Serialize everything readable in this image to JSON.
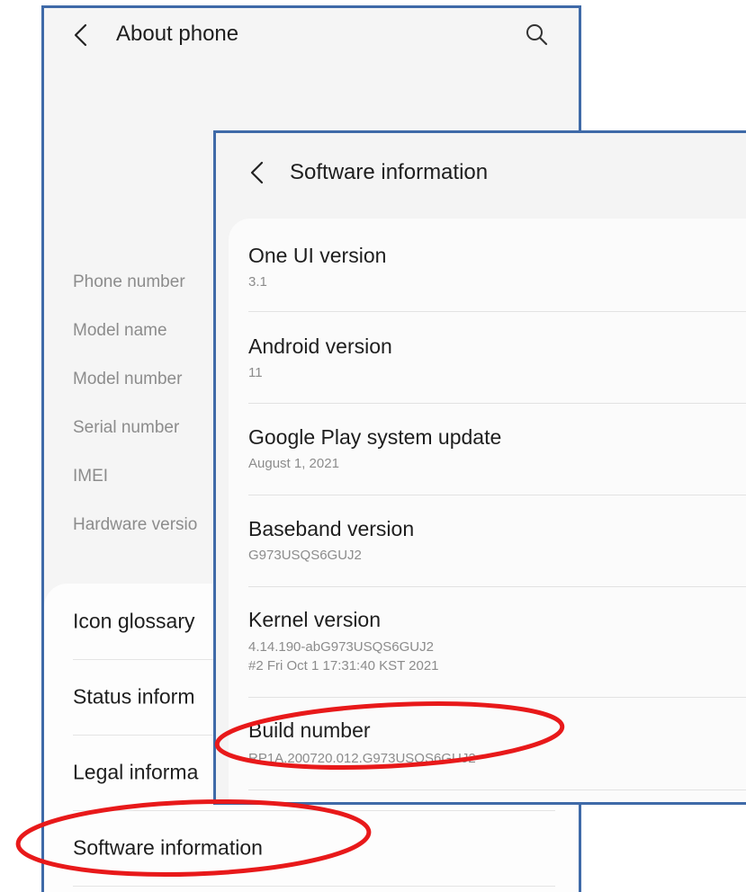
{
  "about_phone": {
    "title": "About phone",
    "back_icon": "chevron-left-icon",
    "search_icon": "search-icon",
    "info_labels": [
      "Phone number",
      "Model name",
      "Model number",
      "Serial number",
      "IMEI",
      "Hardware versio"
    ],
    "menu_items": [
      "Icon glossary",
      "Status inform",
      "Legal informa",
      "Software information"
    ]
  },
  "software_information": {
    "title": "Software information",
    "back_icon": "chevron-left-icon",
    "items": [
      {
        "title": "One UI version",
        "value": "3.1"
      },
      {
        "title": "Android version",
        "value": "11"
      },
      {
        "title": "Google Play system update",
        "value": "August 1, 2021"
      },
      {
        "title": "Baseband version",
        "value": "G973USQS6GUJ2"
      },
      {
        "title": "Kernel version",
        "value": "4.14.190-abG973USQS6GUJ2",
        "value2": "#2 Fri Oct 1 17:31:40 KST 2021"
      },
      {
        "title": "Build number",
        "value": "RP1A.200720.012.G973USQS6GUJ2"
      }
    ]
  },
  "colors": {
    "frame_border": "#3f6aa8",
    "highlight": "#e8191a",
    "background": "#f5f5f5",
    "text_primary": "#1e1e1e",
    "text_secondary": "#8c8c8c"
  }
}
